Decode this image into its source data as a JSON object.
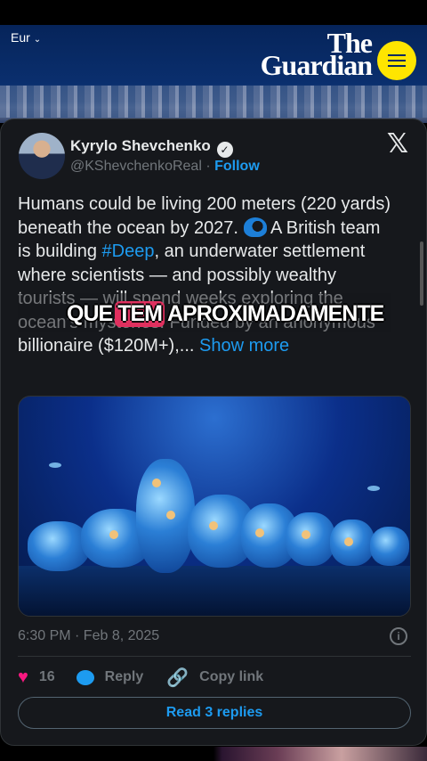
{
  "guardian": {
    "edition_label": "Eur",
    "logo_line1": "The",
    "logo_line2": "Guardian"
  },
  "tweet": {
    "author_name": "Kyrylo Shevchenko",
    "handle": "@KShevchenkoReal",
    "separator": " · ",
    "follow_label": "Follow",
    "text_part1": "Humans could be living 200 meters (220 yards) beneath the ocean by 2027. ",
    "text_part2": " A British team is building ",
    "hashtag": "#Deep",
    "text_part3": ", an underwater settlement where scientists — and possibly wealthy tourists — will spend weeks exploring the ocean's mysteries. Funded by an anonymous billionaire ($120M+),... ",
    "show_more": "Show more",
    "timestamp": "6:30 PM · Feb 8, 2025",
    "likes": "16",
    "reply_label": "Reply",
    "copy_link_label": "Copy link",
    "read_replies_label": "Read 3 replies"
  },
  "caption": {
    "word1": "QUE",
    "word2": "TEM",
    "word3": "APROXIMADAMENTE"
  },
  "colors": {
    "guardian_navy": "#052962",
    "guardian_yellow": "#ffe500",
    "twitter_blue": "#1d9bf0",
    "like_pink": "#f91880",
    "caption_highlight": "#e0305f"
  }
}
